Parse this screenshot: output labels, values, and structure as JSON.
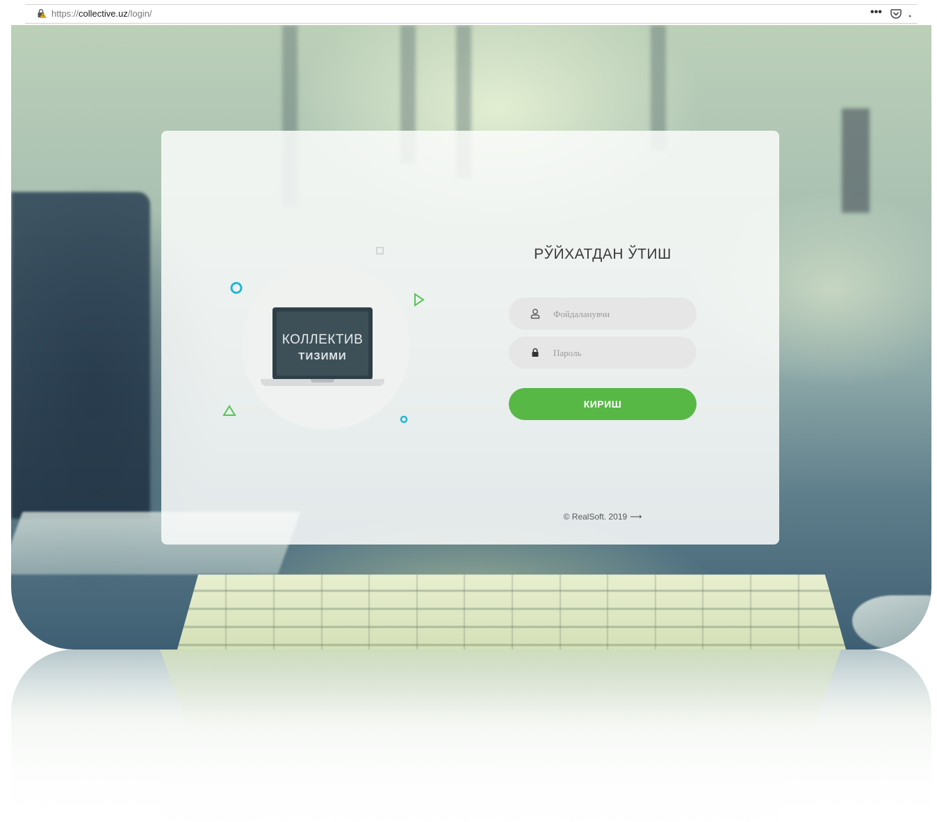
{
  "browser": {
    "url_scheme": "https://",
    "url_host": "collective.uz",
    "url_path": "/login/",
    "menu_label": "•••"
  },
  "illustration": {
    "title": "КОЛЛЕКТИВ",
    "subtitle": "ТИЗИМИ"
  },
  "login": {
    "title": "РЎЙХАТДАН ЎТИШ",
    "username_placeholder": "Фойдаланувчи",
    "password_placeholder": "Пароль",
    "submit_label": "КИРИШ"
  },
  "footer": {
    "copyright": "© RealSoft. 2019",
    "arrow": "⟶"
  },
  "colors": {
    "accent": "#57b846",
    "deco_cyan": "#1fb7d6",
    "deco_green": "#57c25a"
  },
  "icons": [
    "lock-warning-icon",
    "pocket-icon",
    "user-icon",
    "lock-icon",
    "arrow-right-icon"
  ]
}
